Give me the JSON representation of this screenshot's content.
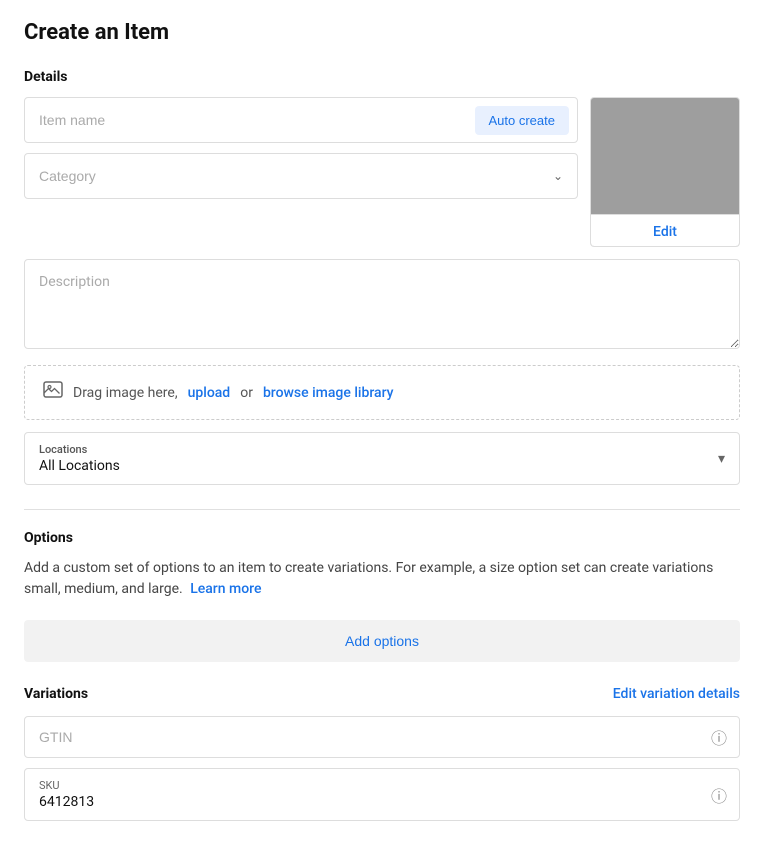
{
  "page": {
    "title": "Create an Item"
  },
  "details": {
    "section_label": "Details",
    "item_name_placeholder": "Item name",
    "auto_create_label": "Auto create",
    "category_placeholder": "Category",
    "description_placeholder": "Description",
    "drag_image_text": "Drag image here, ",
    "drag_image_upload": "upload",
    "drag_image_or": " or ",
    "drag_image_browse": "browse image library",
    "image_edit_label": "Edit",
    "locations_label": "Locations",
    "locations_value": "All Locations"
  },
  "options": {
    "section_label": "Options",
    "description": "Add a custom set of options to an item to create variations. For example, a size option set can create variations small, medium, and large.",
    "learn_more": "Learn more",
    "add_options_label": "Add options"
  },
  "variations": {
    "section_label": "Variations",
    "edit_link": "Edit variation details",
    "gtin_placeholder": "GTIN",
    "sku_label": "SKU",
    "sku_value": "6412813"
  },
  "icons": {
    "image": "🖼",
    "chevron_down": "⌄",
    "info": "ⓘ"
  }
}
